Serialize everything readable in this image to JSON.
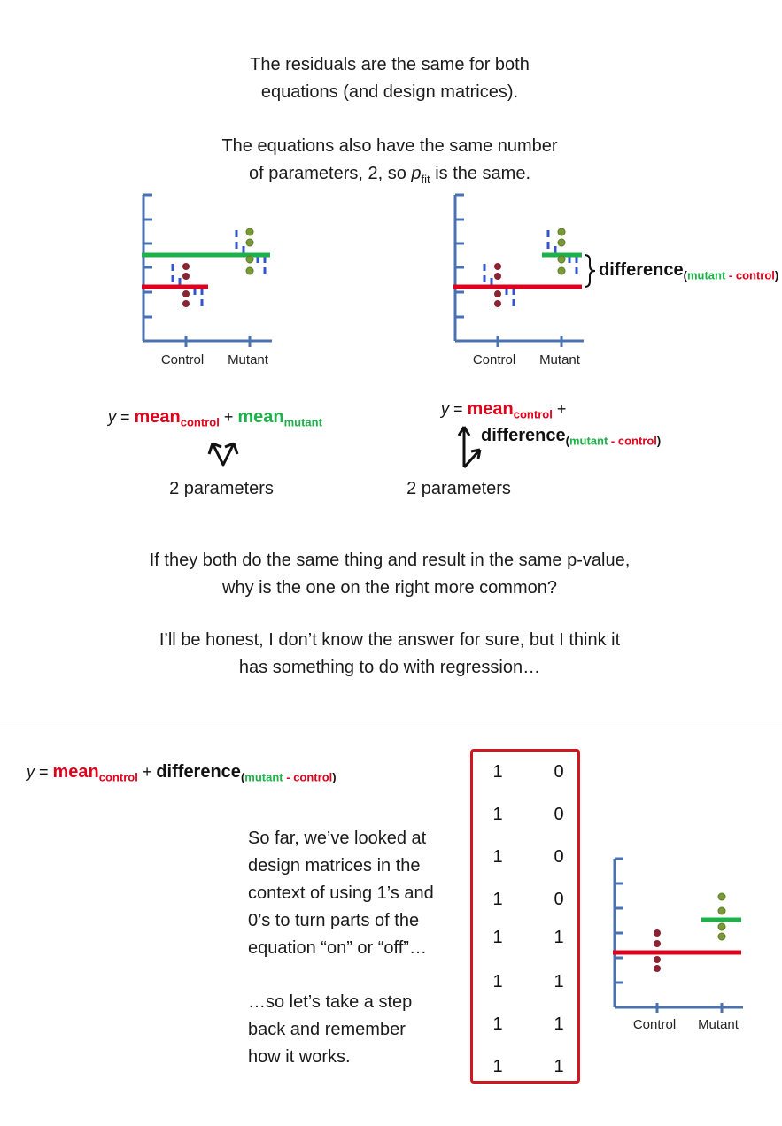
{
  "top": {
    "para1": [
      "The residuals are the same for both",
      "equations (and design matrices)."
    ],
    "para2_line1": "The equations also have the same number",
    "para2_line2_pre": "of parameters, 2, so ",
    "para2_p": "p",
    "para2_fit": "fit",
    "para2_line2_post": " is the same.",
    "left_plot": {
      "x_labels": [
        "Control",
        "Mutant"
      ]
    },
    "right_plot": {
      "x_labels": [
        "Control",
        "Mutant"
      ],
      "brace_label": "difference",
      "brace_sub_open": "(",
      "brace_sub_mutant": "mutant",
      "brace_sub_sep": " - ",
      "brace_sub_control": "control",
      "brace_sub_close": ")"
    },
    "left_eq": {
      "y": "y",
      "eq": " = ",
      "mean": "mean",
      "control": "control",
      "plus": " + ",
      "mean2": "mean",
      "mutant": "mutant"
    },
    "right_eq": {
      "y": "y",
      "eq": " = ",
      "mean": "mean",
      "control": "control",
      "plus": " +",
      "difference": "difference",
      "sub_open": "(",
      "sub_mutant": "mutant",
      "sub_sep": " - ",
      "sub_control": "control",
      "sub_close": ")"
    },
    "left_params": "2 parameters",
    "right_params": "2 parameters"
  },
  "mid": {
    "q1": "If they both do the same thing and result in the same p-value,",
    "q2": "why is the one on the right more common?",
    "a1": "I’ll be honest, I don’t know the answer for sure, but I think it",
    "a2": "has something to do with regression…"
  },
  "bottom": {
    "eq": {
      "y": "y",
      "eq": " = ",
      "mean": "mean",
      "control": "control",
      "plus": " + ",
      "difference": "difference",
      "sub_open": "(",
      "sub_mutant": "mutant",
      "sub_sep": " - ",
      "sub_control": "control",
      "sub_close": ")"
    },
    "text1": [
      "So far, we’ve looked at",
      "design matrices in the",
      "context of using 1’s and",
      "0’s to turn parts of the",
      "equation “on” or “off”…"
    ],
    "text2": [
      "…so let’s take a step",
      "back and remember",
      "how it works."
    ],
    "matrix": [
      [
        "1",
        "0"
      ],
      [
        "1",
        "0"
      ],
      [
        "1",
        "0"
      ],
      [
        "1",
        "0"
      ],
      [
        "1",
        "1"
      ],
      [
        "1",
        "1"
      ],
      [
        "1",
        "1"
      ],
      [
        "1",
        "1"
      ]
    ],
    "plot": {
      "x_labels": [
        "Control",
        "Mutant"
      ]
    }
  },
  "colors": {
    "red": "#e0001b",
    "green": "#1db249",
    "axis": "#4a72b0",
    "residual": "#3355cc",
    "dot_control": "#8b2332",
    "dot_mutant": "#7a9a3a"
  },
  "icons": {
    "double_arrow": "double-arrow-icon",
    "brace": "curly-brace-icon"
  }
}
